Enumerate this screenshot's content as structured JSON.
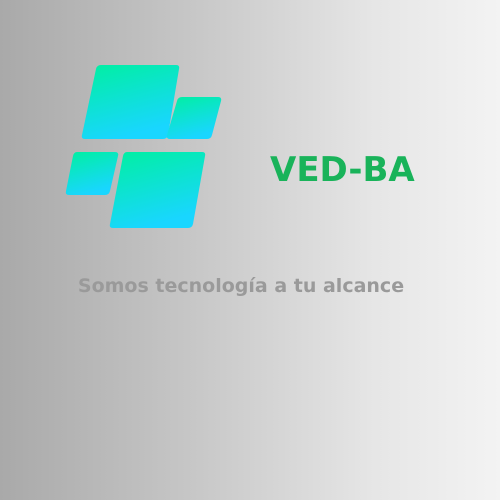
{
  "brand": {
    "name": "VED-BA",
    "name_color": "#19b35a"
  },
  "tagline": {
    "text": "Somos tecnología a tu alcance",
    "color": "#9a9a9a"
  },
  "logo": {
    "icon": "four-panel-logo-icon",
    "gradient_start": "#00f0a0",
    "gradient_end": "#19d6ff"
  },
  "background": {
    "gradient_from": "#a9a9a9",
    "gradient_to": "#f3f3f3"
  }
}
